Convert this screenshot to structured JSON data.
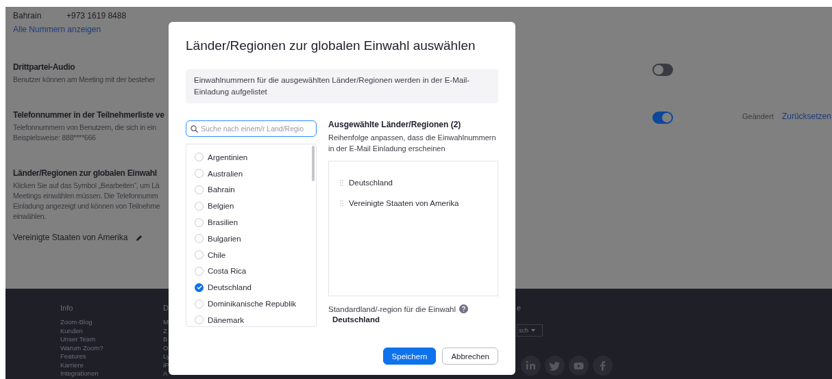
{
  "page": {
    "phone_rows": [
      {
        "country": "Bahrain",
        "number": "+973 1619 8488"
      }
    ],
    "show_all_link": "Alle Nummern anzeigen",
    "settings": [
      {
        "title": "Drittpartei-Audio",
        "description": [
          "Benutzer können am Meeting mit der besteher"
        ],
        "toggle": {
          "on": false
        }
      },
      {
        "title": "Telefonnummer in der Teilnehmerliste ve",
        "description": [
          "Telefonnummern von Benutzern, die sich in ein",
          "Beispielsweise: 888****666"
        ],
        "toggle": {
          "on": true
        },
        "status": "Geändert",
        "reset_link": "Zurücksetzen"
      },
      {
        "title": "Länder/Regionen zur globalen Einwahl",
        "description": [
          "Klicken Sie auf das Symbol „Bearbeiten“, um Lä",
          "Meetings einwählen müssen. Die Telefonnumm",
          "Einladung angezeigt und können von Teilnehme",
          "einwählen."
        ],
        "value": "Vereinigte Staaten von Amerika"
      }
    ]
  },
  "footer": {
    "columns": [
      {
        "heading": "Info",
        "links": [
          "Zoom-Blog",
          "Kunden",
          "Unser Team",
          "Warum Zoom?",
          "Features",
          "Karriere",
          "Integrationen"
        ]
      },
      {
        "heading": "D",
        "links": [
          "M",
          "Z",
          "B",
          "O",
          "Ly",
          "iP",
          "A"
        ]
      }
    ],
    "language_heading": "e",
    "language_select": "sch"
  },
  "dialog": {
    "title": "Länder/Regionen zur globalen Einwahl auswählen",
    "info": "Einwahlnummern für die ausgewählten Länder/Regionen werden in der E-Mail-Einladung aufgelistet",
    "search": {
      "placeholder": "Suche nach einem/r Land/Regio"
    },
    "countries": [
      {
        "name": "Argentinien",
        "checked": false
      },
      {
        "name": "Australien",
        "checked": false
      },
      {
        "name": "Bahrain",
        "checked": false
      },
      {
        "name": "Belgien",
        "checked": false
      },
      {
        "name": "Brasilien",
        "checked": false
      },
      {
        "name": "Bulgarien",
        "checked": false
      },
      {
        "name": "Chile",
        "checked": false
      },
      {
        "name": "Costa Rica",
        "checked": false
      },
      {
        "name": "Deutschland",
        "checked": true
      },
      {
        "name": "Dominikanische Republik",
        "checked": false
      },
      {
        "name": "Dänemark",
        "checked": false
      }
    ],
    "selected_heading": "Ausgewählte Länder/Regionen (2)",
    "selected_hint": "Reihenfolge anpassen, dass die Einwahlnummern in der E-Mail Einladung erscheinen",
    "selected": [
      "Deutschland",
      "Vereinigte Staaten von Amerika"
    ],
    "default_label": "Standardland/-region für die Einwahl",
    "default_value": "Deutschland",
    "buttons": [
      {
        "label": "Speichern",
        "kind": "primary"
      },
      {
        "label": "Abbrechen",
        "kind": "secondary"
      }
    ]
  }
}
